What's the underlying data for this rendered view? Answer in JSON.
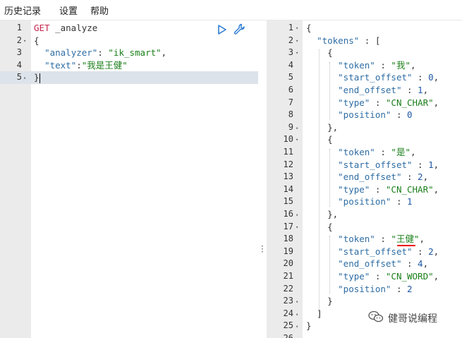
{
  "menu": {
    "history": "历史记录",
    "settings": "设置",
    "help": "帮助"
  },
  "request": {
    "lines": [
      {
        "n": "1",
        "fold": "",
        "tokens": [
          [
            "t-method",
            "GET"
          ],
          [
            "t-plain",
            " _analyze"
          ]
        ]
      },
      {
        "n": "2",
        "fold": "▾",
        "tokens": [
          [
            "t-punc",
            "{"
          ]
        ]
      },
      {
        "n": "3",
        "fold": "",
        "tokens": [
          [
            "t-plain",
            "  "
          ],
          [
            "t-key",
            "\"analyzer\""
          ],
          [
            "t-punc",
            ": "
          ],
          [
            "t-str",
            "\"ik_smart\""
          ],
          [
            "t-punc",
            ","
          ]
        ]
      },
      {
        "n": "4",
        "fold": "",
        "tokens": [
          [
            "t-plain",
            "  "
          ],
          [
            "t-key",
            "\"text\""
          ],
          [
            "t-punc",
            ":"
          ],
          [
            "t-str",
            "\"我是王健\""
          ]
        ]
      },
      {
        "n": "5",
        "fold": "▴",
        "tokens": [
          [
            "t-punc",
            "}"
          ]
        ]
      }
    ]
  },
  "response": {
    "lines": [
      {
        "n": "1",
        "fold": "▾",
        "tokens": [
          [
            "t-punc",
            "{"
          ]
        ]
      },
      {
        "n": "2",
        "fold": "▾",
        "tokens": [
          [
            "t-plain",
            "  "
          ],
          [
            "t-key",
            "\"tokens\""
          ],
          [
            "t-punc",
            " : ["
          ]
        ]
      },
      {
        "n": "3",
        "fold": "▾",
        "tokens": [
          [
            "t-plain",
            "    "
          ],
          [
            "t-punc",
            "{"
          ]
        ]
      },
      {
        "n": "4",
        "fold": "",
        "tokens": [
          [
            "t-plain",
            "      "
          ],
          [
            "t-key",
            "\"token\""
          ],
          [
            "t-punc",
            " : "
          ],
          [
            "t-str",
            "\"我\""
          ],
          [
            "t-punc",
            ","
          ]
        ]
      },
      {
        "n": "5",
        "fold": "",
        "tokens": [
          [
            "t-plain",
            "      "
          ],
          [
            "t-key",
            "\"start_offset\""
          ],
          [
            "t-punc",
            " : "
          ],
          [
            "t-num",
            "0"
          ],
          [
            "t-punc",
            ","
          ]
        ]
      },
      {
        "n": "6",
        "fold": "",
        "tokens": [
          [
            "t-plain",
            "      "
          ],
          [
            "t-key",
            "\"end_offset\""
          ],
          [
            "t-punc",
            " : "
          ],
          [
            "t-num",
            "1"
          ],
          [
            "t-punc",
            ","
          ]
        ]
      },
      {
        "n": "7",
        "fold": "",
        "tokens": [
          [
            "t-plain",
            "      "
          ],
          [
            "t-key",
            "\"type\""
          ],
          [
            "t-punc",
            " : "
          ],
          [
            "t-str",
            "\"CN_CHAR\""
          ],
          [
            "t-punc",
            ","
          ]
        ]
      },
      {
        "n": "8",
        "fold": "",
        "tokens": [
          [
            "t-plain",
            "      "
          ],
          [
            "t-key",
            "\"position\""
          ],
          [
            "t-punc",
            " : "
          ],
          [
            "t-num",
            "0"
          ]
        ]
      },
      {
        "n": "9",
        "fold": "▴",
        "tokens": [
          [
            "t-plain",
            "    "
          ],
          [
            "t-punc",
            "},"
          ]
        ]
      },
      {
        "n": "10",
        "fold": "▾",
        "tokens": [
          [
            "t-plain",
            "    "
          ],
          [
            "t-punc",
            "{"
          ]
        ]
      },
      {
        "n": "11",
        "fold": "",
        "tokens": [
          [
            "t-plain",
            "      "
          ],
          [
            "t-key",
            "\"token\""
          ],
          [
            "t-punc",
            " : "
          ],
          [
            "t-str",
            "\"是\""
          ],
          [
            "t-punc",
            ","
          ]
        ]
      },
      {
        "n": "12",
        "fold": "",
        "tokens": [
          [
            "t-plain",
            "      "
          ],
          [
            "t-key",
            "\"start_offset\""
          ],
          [
            "t-punc",
            " : "
          ],
          [
            "t-num",
            "1"
          ],
          [
            "t-punc",
            ","
          ]
        ]
      },
      {
        "n": "13",
        "fold": "",
        "tokens": [
          [
            "t-plain",
            "      "
          ],
          [
            "t-key",
            "\"end_offset\""
          ],
          [
            "t-punc",
            " : "
          ],
          [
            "t-num",
            "2"
          ],
          [
            "t-punc",
            ","
          ]
        ]
      },
      {
        "n": "14",
        "fold": "",
        "tokens": [
          [
            "t-plain",
            "      "
          ],
          [
            "t-key",
            "\"type\""
          ],
          [
            "t-punc",
            " : "
          ],
          [
            "t-str",
            "\"CN_CHAR\""
          ],
          [
            "t-punc",
            ","
          ]
        ]
      },
      {
        "n": "15",
        "fold": "",
        "tokens": [
          [
            "t-plain",
            "      "
          ],
          [
            "t-key",
            "\"position\""
          ],
          [
            "t-punc",
            " : "
          ],
          [
            "t-num",
            "1"
          ]
        ]
      },
      {
        "n": "16",
        "fold": "▴",
        "tokens": [
          [
            "t-plain",
            "    "
          ],
          [
            "t-punc",
            "},"
          ]
        ]
      },
      {
        "n": "17",
        "fold": "▾",
        "tokens": [
          [
            "t-plain",
            "    "
          ],
          [
            "t-punc",
            "{"
          ]
        ]
      },
      {
        "n": "18",
        "fold": "",
        "tokens": [
          [
            "t-plain",
            "      "
          ],
          [
            "t-key",
            "\"token\""
          ],
          [
            "t-punc",
            " : "
          ],
          [
            "t-str",
            "\"王健\""
          ],
          [
            "t-punc",
            ","
          ]
        ]
      },
      {
        "n": "19",
        "fold": "",
        "tokens": [
          [
            "t-plain",
            "      "
          ],
          [
            "t-key",
            "\"start_offset\""
          ],
          [
            "t-punc",
            " : "
          ],
          [
            "t-num",
            "2"
          ],
          [
            "t-punc",
            ","
          ]
        ]
      },
      {
        "n": "20",
        "fold": "",
        "tokens": [
          [
            "t-plain",
            "      "
          ],
          [
            "t-key",
            "\"end_offset\""
          ],
          [
            "t-punc",
            " : "
          ],
          [
            "t-num",
            "4"
          ],
          [
            "t-punc",
            ","
          ]
        ]
      },
      {
        "n": "21",
        "fold": "",
        "tokens": [
          [
            "t-plain",
            "      "
          ],
          [
            "t-key",
            "\"type\""
          ],
          [
            "t-punc",
            " : "
          ],
          [
            "t-str",
            "\"CN_WORD\""
          ],
          [
            "t-punc",
            ","
          ]
        ]
      },
      {
        "n": "22",
        "fold": "",
        "tokens": [
          [
            "t-plain",
            "      "
          ],
          [
            "t-key",
            "\"position\""
          ],
          [
            "t-punc",
            " : "
          ],
          [
            "t-num",
            "2"
          ]
        ]
      },
      {
        "n": "23",
        "fold": "▴",
        "tokens": [
          [
            "t-plain",
            "    "
          ],
          [
            "t-punc",
            "}"
          ]
        ]
      },
      {
        "n": "24",
        "fold": "▴",
        "tokens": [
          [
            "t-plain",
            "  "
          ],
          [
            "t-punc",
            "]"
          ]
        ]
      },
      {
        "n": "25",
        "fold": "▴",
        "tokens": [
          [
            "t-punc",
            "}"
          ]
        ]
      },
      {
        "n": "26",
        "fold": "",
        "tokens": []
      }
    ]
  },
  "icons": {
    "run": "play-icon",
    "settings": "wrench-icon",
    "watermark": "wechat-icon"
  },
  "watermark": {
    "text": "健哥说编程"
  },
  "colors": {
    "active_line": "#dde3ea",
    "gutter": "#ebebeb",
    "underline": "#ee0000"
  }
}
